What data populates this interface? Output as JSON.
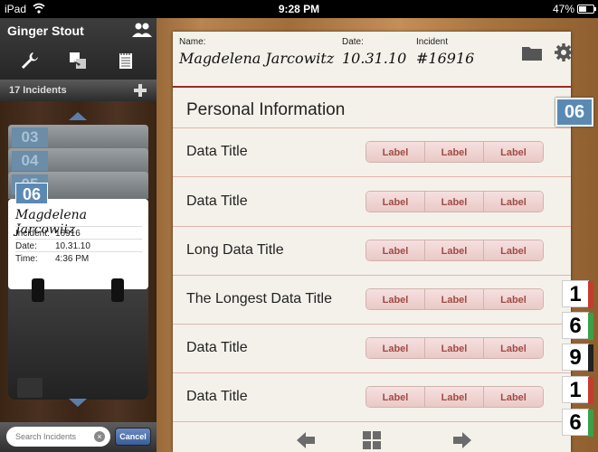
{
  "status_bar": {
    "carrier": "iPad",
    "time": "9:28 PM",
    "battery_percent": "47%",
    "battery_level": 0.47
  },
  "sidebar": {
    "user_name": "Ginger Stout",
    "incident_count": "17 Incidents",
    "back_tabs": [
      "03",
      "04",
      "05"
    ],
    "card": {
      "tab": "06",
      "name": "Magdelena Jarcowitz",
      "rows": [
        {
          "key": "Incident:",
          "value": "16916"
        },
        {
          "key": "Date:",
          "value": "10.31.10"
        },
        {
          "key": "Time:",
          "value": "4:36 PM"
        }
      ]
    },
    "search_placeholder": "Search Incidents",
    "cancel_label": "Cancel"
  },
  "header": {
    "name_label": "Name:",
    "name_value": "Magdelena Jarcowitz",
    "date_label": "Date:",
    "date_value": "10.31.10",
    "incident_label": "Incident",
    "incident_value": "#16916"
  },
  "section_title": "Personal Information",
  "rows": [
    {
      "title": "Data Title",
      "labels": [
        "Label",
        "Label",
        "Label"
      ]
    },
    {
      "title": "Data Title",
      "labels": [
        "Label",
        "Label",
        "Label"
      ]
    },
    {
      "title": "Long Data Title",
      "labels": [
        "Label",
        "Label",
        "Label"
      ]
    },
    {
      "title": "The Longest Data Title",
      "labels": [
        "Label",
        "Label",
        "Label"
      ]
    },
    {
      "title": "Data Title",
      "labels": [
        "Label",
        "Label",
        "Label"
      ]
    },
    {
      "title": "Data Title",
      "labels": [
        "Label",
        "Label",
        "Label"
      ]
    }
  ],
  "side_tab": "06",
  "digit_tabs": [
    {
      "digit": "1",
      "color": "#c43c2c"
    },
    {
      "digit": "6",
      "color": "#3aa04a"
    },
    {
      "digit": "9",
      "color": "#222222"
    },
    {
      "digit": "1",
      "color": "#c43c2c"
    },
    {
      "digit": "6",
      "color": "#3aa04a"
    }
  ],
  "colors": {
    "accent_blue": "#5a8ab4",
    "header_rule": "#9b2a25",
    "segment_text": "#a14b45"
  }
}
